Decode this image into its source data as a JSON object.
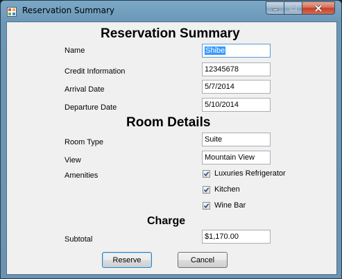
{
  "window": {
    "title": "Reservation Summary",
    "controls": {
      "minimize": "minimize-icon",
      "maximize": "maximize-icon",
      "close": "close-icon"
    }
  },
  "form": {
    "summary_heading": "Reservation Summary",
    "fields": {
      "name": {
        "label": "Name",
        "value": "Shibe"
      },
      "credit": {
        "label": "Credit Information",
        "value": "12345678"
      },
      "arrival": {
        "label": "Arrival Date",
        "value": "5/7/2014"
      },
      "departure": {
        "label": "Departure Date",
        "value": "5/10/2014"
      }
    },
    "room_heading": "Room Details",
    "room": {
      "type": {
        "label": "Room Type",
        "value": "Suite"
      },
      "view": {
        "label": "View",
        "value": "Mountain View"
      },
      "amenities_label": "Amenities",
      "amenities": [
        {
          "label": "Luxuries Refrigerator",
          "checked": true
        },
        {
          "label": "Kitchen",
          "checked": true
        },
        {
          "label": "Wine Bar",
          "checked": true
        }
      ]
    },
    "charge_heading": "Charge",
    "subtotal": {
      "label": "Subtotal",
      "value": "$1,170.00"
    },
    "buttons": {
      "reserve": "Reserve",
      "cancel": "Cancel"
    }
  },
  "colors": {
    "titlebar": "#6b97b6",
    "client": "#f0f0f0",
    "selection": "#3399ff",
    "close": "#c2402a"
  }
}
